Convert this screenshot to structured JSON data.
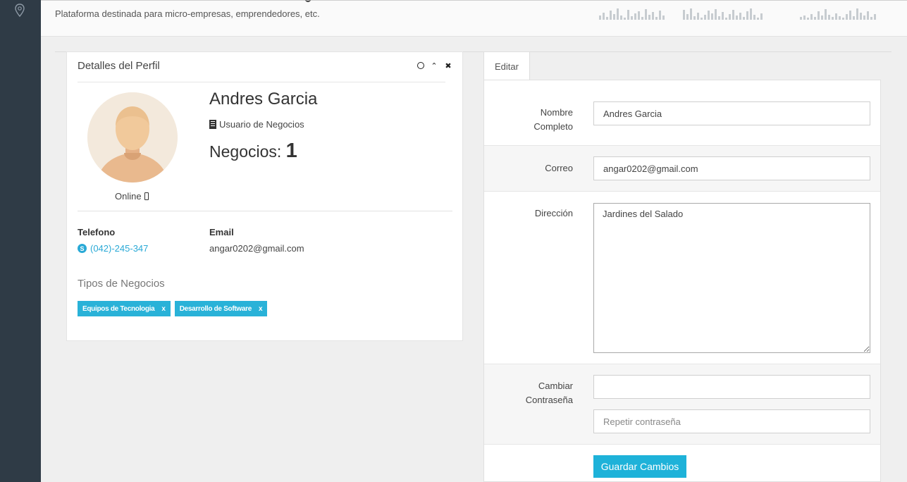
{
  "header": {
    "subtitle": "Plataforma destinada para micro-empresas, emprendedores, etc."
  },
  "profile_panel": {
    "title": "Detalles del Perfil",
    "name": "Andres Garcia",
    "role": "Usuario de Negocios",
    "negocios_label": "Negocios:",
    "negocios_count": "1",
    "status": "Online",
    "telefono_label": "Telefono",
    "telefono_value": "(042)-245-347",
    "email_label": "Email",
    "email_value": "angar0202@gmail.com",
    "tipos_label": "Tipos de Negocios",
    "tags": [
      {
        "label": "Equipos de Tecnologia",
        "remove": "x"
      },
      {
        "label": "Desarrollo de Software",
        "remove": "x"
      }
    ]
  },
  "edit_form": {
    "tab_label": "Editar",
    "nombre_label": "Nombre Completo",
    "nombre_value": "Andres Garcia",
    "correo_label": "Correo",
    "correo_value": "angar0202@gmail.com",
    "direccion_label": "Dirección",
    "direccion_value": "Jardines del Salado",
    "password_label": "Cambiar Contraseña",
    "password_value": "",
    "repeat_placeholder": "Repetir contraseña",
    "save_label": "Guardar Cambios"
  },
  "colors": {
    "sidebar": "#2f3b46",
    "accent": "#29b2d8",
    "button": "#1eb2d9",
    "link": "#29a9d6"
  }
}
